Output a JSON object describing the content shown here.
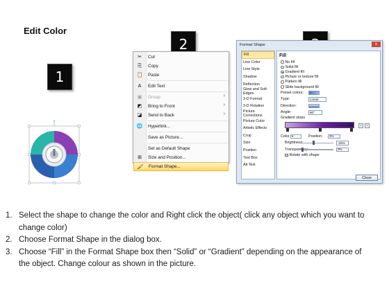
{
  "page": {
    "title": "Edit Color",
    "steps": [
      "1",
      "2",
      "3"
    ]
  },
  "context_menu": {
    "items": [
      {
        "label": "Cut",
        "icon": "scissors-icon",
        "disabled": false,
        "submenu": false
      },
      {
        "label": "Copy",
        "icon": "copy-icon",
        "disabled": false,
        "submenu": false
      },
      {
        "label": "Paste",
        "icon": "paste-icon",
        "disabled": false,
        "submenu": false
      },
      {
        "label": "Edit Text",
        "icon": "edit-text-icon",
        "disabled": false,
        "submenu": false
      },
      {
        "label": "Group",
        "icon": "group-icon",
        "disabled": true,
        "submenu": true
      },
      {
        "label": "Bring to Front",
        "icon": "bring-front-icon",
        "disabled": false,
        "submenu": true
      },
      {
        "label": "Send to Back",
        "icon": "send-back-icon",
        "disabled": false,
        "submenu": true
      },
      {
        "label": "Hyperlink...",
        "icon": "hyperlink-icon",
        "disabled": false,
        "submenu": false
      },
      {
        "label": "Save as Picture...",
        "icon": "",
        "disabled": false,
        "submenu": false
      },
      {
        "label": "Set as Default Shape",
        "icon": "",
        "disabled": false,
        "submenu": false
      },
      {
        "label": "Size and Position...",
        "icon": "size-position-icon",
        "disabled": false,
        "submenu": false
      },
      {
        "label": "Format Shape...",
        "icon": "format-shape-icon",
        "disabled": false,
        "submenu": false,
        "highlighted": true
      }
    ]
  },
  "dialog": {
    "title": "Format Shape",
    "close_glyph": "x",
    "nav": [
      "Fill",
      "Line Color",
      "Line Style",
      "Shadow",
      "Reflection",
      "Glow and Soft Edges",
      "3-D Format",
      "3-D Rotation",
      "Picture Corrections",
      "Picture Color",
      "Artistic Effects",
      "Crop",
      "Size",
      "Position",
      "Text Box",
      "Alt Text"
    ],
    "nav_selected": "Fill",
    "section_title": "Fill",
    "fill_options": [
      {
        "label": "No fill",
        "selected": false
      },
      {
        "label": "Solid fill",
        "selected": false
      },
      {
        "label": "Gradient fill",
        "selected": true
      },
      {
        "label": "Picture or texture fill",
        "selected": false
      },
      {
        "label": "Pattern fill",
        "selected": false
      },
      {
        "label": "Slide background fill",
        "selected": false
      }
    ],
    "preset_colors_label": "Preset colors:",
    "type_label": "Type:",
    "type_value": "Linear",
    "direction_label": "Direction:",
    "angle_label": "Angle:",
    "angle_value": "90°",
    "gradient_stops_label": "Gradient stops",
    "color_label": "Color",
    "position_label": "Position:",
    "position_value": "3%",
    "brightness_label": "Brightness:",
    "brightness_value": "-25%",
    "transparency_label": "Transparency:",
    "transparency_value": "0%",
    "rotate_label": "Rotate with shape",
    "rotate_checked": true,
    "close_label": "Close"
  },
  "instructions": [
    {
      "num": "1.",
      "text": "Select the shape to change the color and Right click the object( click any object which you want to change color)"
    },
    {
      "num": "2.",
      "text": "Choose Format Shape in the dialog box."
    },
    {
      "num": "3.",
      "text": "Choose “Fill” in the Format Shape box then “Solid” or “Gradient” depending on the appearance of the object. Change colour as shown in the picture."
    }
  ],
  "colors": {
    "gradient_start": "#caa4e4",
    "gradient_mid": "#6a1fa8",
    "gradient_end": "#3a0d6a",
    "menu_highlight": "#ffd766",
    "shape_teal": "#2bb5a8",
    "shape_blue": "#2a6fc0",
    "shape_purple": "#8a3fb5"
  }
}
